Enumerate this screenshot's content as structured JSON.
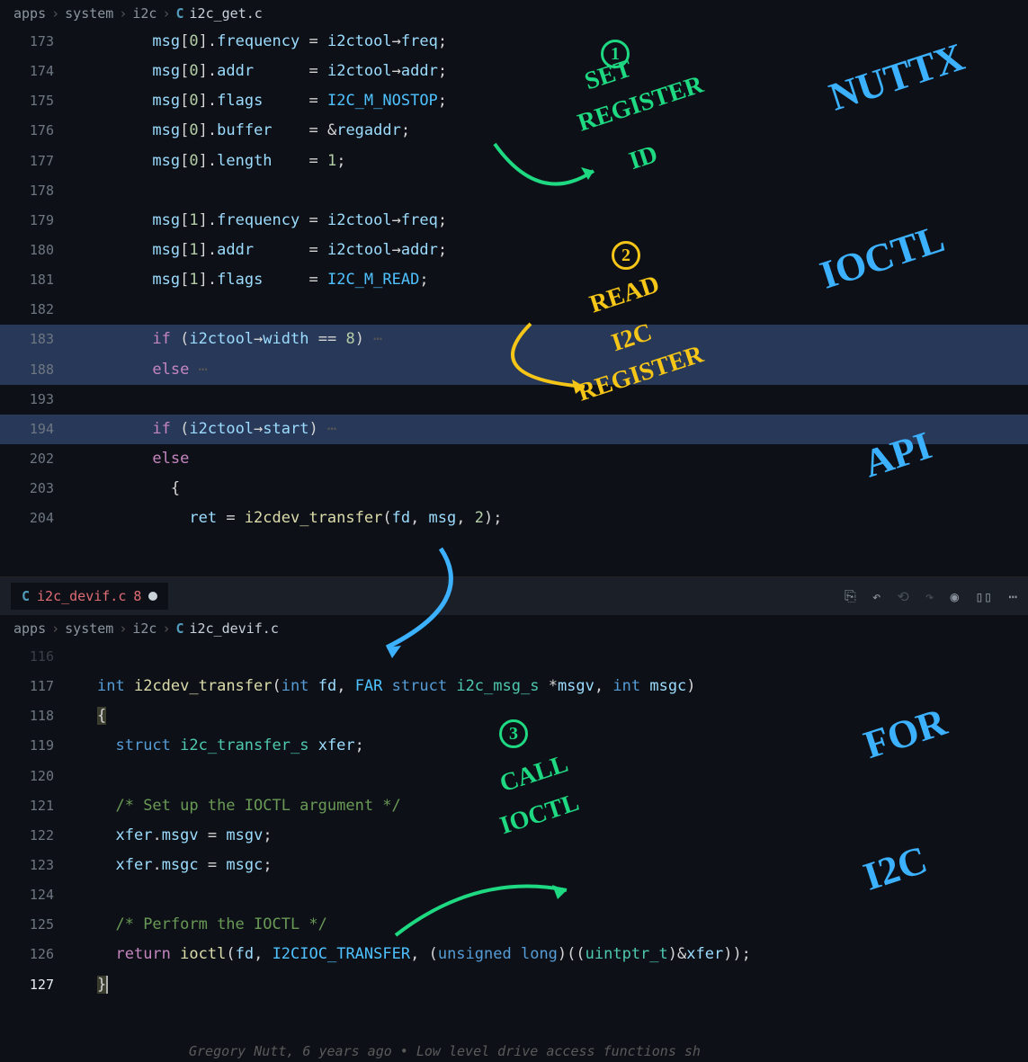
{
  "breadcrumb1": {
    "seg1": "apps",
    "seg2": "system",
    "seg3": "i2c",
    "lang": "C",
    "file": "i2c_get.c"
  },
  "tab2": {
    "lang": "C",
    "name": "i2c_devif.c",
    "badge": "8"
  },
  "breadcrumb2": {
    "seg1": "apps",
    "seg2": "system",
    "seg3": "i2c",
    "lang": "C",
    "file": "i2c_devif.c"
  },
  "pane1": {
    "lines": {
      "l173": "173",
      "l174": "174",
      "l175": "175",
      "l176": "176",
      "l177": "177",
      "l178": "178",
      "l179": "179",
      "l180": "180",
      "l181": "181",
      "l182": "182",
      "l183": "183",
      "l188": "188",
      "l193": "193",
      "l194": "194",
      "l202": "202",
      "l203": "203",
      "l204": "204"
    },
    "code": {
      "c173a": "msg",
      "c173b": "[",
      "c173c": "0",
      "c173d": "].",
      "c173e": "frequency",
      "c173f": " = ",
      "c173g": "i2ctool",
      "c173h": "→",
      "c173i": "freq",
      "c173j": ";",
      "c174e": "addr",
      "c174f": "      = ",
      "c174i": "addr",
      "c175e": "flags",
      "c175f": "     = ",
      "c175g": "I2C_M_NOSTOP",
      "c176e": "buffer",
      "c176f": "    = &",
      "c176g": "regaddr",
      "c177e": "length",
      "c177f": "    = ",
      "c177g": "1",
      "c179c": "1",
      "c181g": "I2C_M_READ",
      "if": "if",
      "else": "else",
      "lpar": " (",
      "rpar": ")",
      "wid": "width",
      "eq": " == ",
      "eight": "8",
      "e1": " ⋯",
      "start": "start",
      "lbr": "  {",
      "ret": "    ret",
      "asg": " = ",
      "fn": "i2cdev_transfer",
      "args1": "(",
      "fd": "fd",
      "com": ", ",
      "msg": "msg",
      "two": "2",
      "rp2": ");"
    }
  },
  "pane2": {
    "lines": {
      "l116": "116",
      "l117": "117",
      "l118": "118",
      "l119": "119",
      "l120": "120",
      "l121": "121",
      "l122": "122",
      "l123": "123",
      "l124": "124",
      "l125": "125",
      "l126": "126",
      "l127": "127"
    },
    "code": {
      "tint": "int",
      "fn": "i2cdev_transfer",
      "lp": "(",
      "fd": "fd",
      "com": ", ",
      "far": "FAR",
      "struct": "struct",
      "ms": "i2c_msg_s",
      "star": " *",
      "mv": "msgv",
      "mc": "msgc",
      "rp": ")",
      "ob": "{",
      "cb": "}",
      "xs": "i2c_transfer_s",
      "xfer": "xfer",
      "semi": ";",
      "cm1": "/* Set up the IOCTL argument */",
      "x1": "xfer",
      "dm": ".",
      "mvf": "msgv",
      "eq": " = ",
      "mcf": "msgc",
      "cm2": "/* Perform the IOCTL */",
      "ret": "return",
      "ioctl": "ioctl",
      "ic": "I2CIOC_TRANSFER",
      "ul": "unsigned",
      "long": "long",
      "up": "uintptr_t",
      "amp": ")&"
    }
  },
  "blame": "Gregory Nutt, 6 years ago • Low level drive access functions sh",
  "annotations": {
    "n1": "1",
    "set_reg": "SET",
    "set_reg2": "REGISTER",
    "set_reg3": "ID",
    "nuttx": "NUTTX",
    "n2": "2",
    "read": "READ",
    "i2c": "I2C",
    "reg": "REGISTER",
    "ioctl": "IOCTL",
    "api": "API",
    "for": "FOR",
    "i2c2": "I2C",
    "n3": "3",
    "call": "CALL",
    "ioctl2": "IOCTL"
  }
}
